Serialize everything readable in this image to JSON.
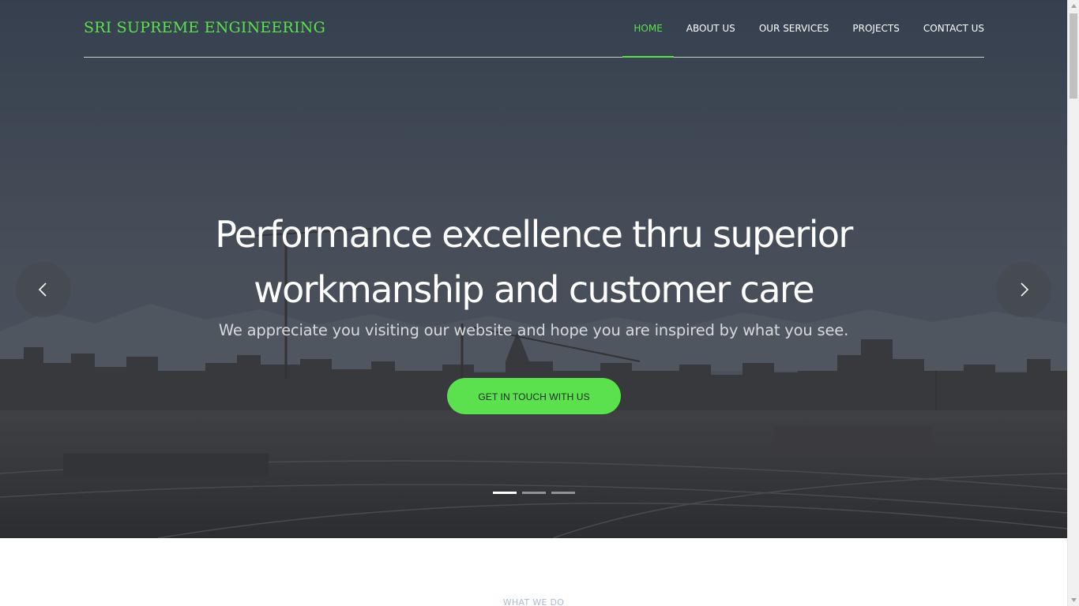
{
  "header": {
    "logo": "SRI SUPREME ENGINEERING",
    "nav": [
      {
        "label": "HOME",
        "active": true
      },
      {
        "label": "ABOUT US",
        "active": false
      },
      {
        "label": "OUR SERVICES",
        "active": false
      },
      {
        "label": "PROJECTS",
        "active": false
      },
      {
        "label": "CONTACT US",
        "active": false
      }
    ]
  },
  "hero": {
    "headline_line1": "Performance excellence thru superior",
    "headline_line2": "workmanship and customer care",
    "subline": "We appreciate you visiting our website and hope you are inspired by what you see.",
    "cta_label": "GET IN TOUCH WITH US",
    "prev_icon": "chevron-left-icon",
    "next_icon": "chevron-right-icon",
    "slide_count": 3,
    "active_slide": 1
  },
  "section": {
    "label": "WHAT WE DO"
  },
  "colors": {
    "accent": "#5ce14e",
    "nav_text": "#ffffff",
    "hero_overlay": "#3a4350",
    "section_label": "#a9bcd6"
  }
}
